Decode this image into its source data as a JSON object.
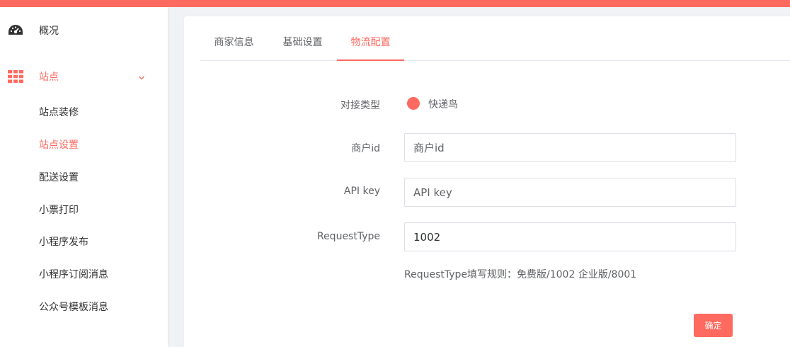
{
  "sidebar": {
    "overview_label": "概况",
    "site_label": "站点",
    "site_subitems": [
      {
        "label": "站点装修"
      },
      {
        "label": "站点设置"
      },
      {
        "label": "配送设置"
      },
      {
        "label": "小票打印"
      },
      {
        "label": "小程序发布"
      },
      {
        "label": "小程序订阅消息"
      },
      {
        "label": "公众号模板消息"
      }
    ],
    "active_subitem": "站点设置"
  },
  "tabs": [
    {
      "label": "商家信息"
    },
    {
      "label": "基础设置"
    },
    {
      "label": "物流配置"
    }
  ],
  "active_tab": "物流配置",
  "form": {
    "type_label": "对接类型",
    "type_option": "快递鸟",
    "merchant_label": "商户id",
    "merchant_placeholder": "商户id",
    "apikey_label": "API key",
    "apikey_placeholder": "API key",
    "requesttype_label": "RequestType",
    "requesttype_value": "1002",
    "hint": "RequestType填写规则：免费版/1002 企业版/8001",
    "submit_label": "确定"
  },
  "colors": {
    "accent": "#ff6a60",
    "text": "#303133",
    "muted": "#606266",
    "border": "#dcdfe6"
  }
}
